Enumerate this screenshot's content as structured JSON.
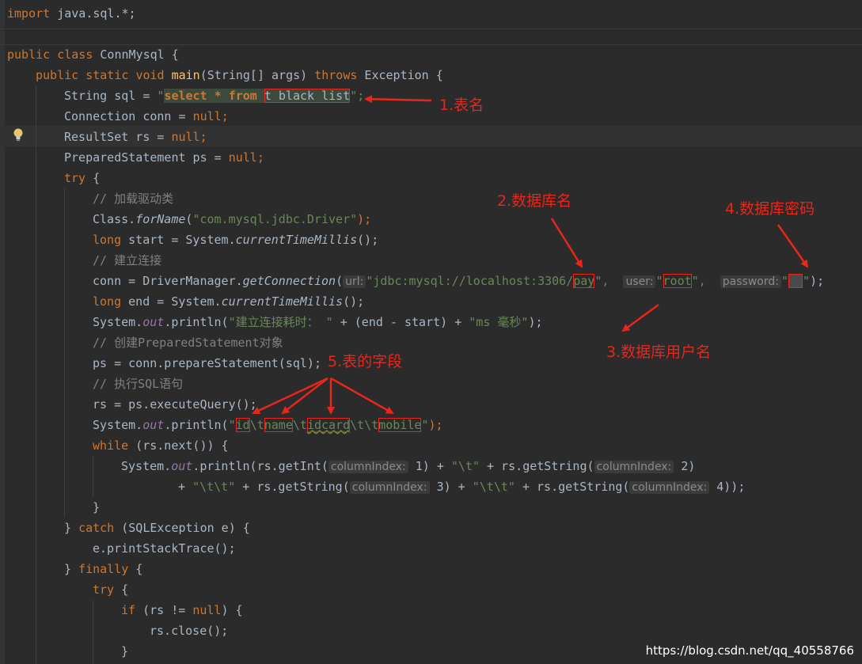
{
  "code": {
    "l01": {
      "a": "import",
      "b": " java.sql.*;"
    },
    "l03": {
      "a": "public",
      "b": " ",
      "c": "class",
      "d": " ConnMysql {"
    },
    "l04": {
      "a": "public",
      "b": " ",
      "c": "static",
      "d": " ",
      "e": "void",
      "f": " ",
      "g": "main",
      "h": "(String[] args) ",
      "i": "throws",
      "j": " Exception {"
    },
    "l05": {
      "a": "String sql = ",
      "b": "\"",
      "c": "select * from",
      "d": " ",
      "e": "t_black_list",
      "f": "\";"
    },
    "l06": {
      "a": "Connection conn = ",
      "b": "null",
      "c": ";"
    },
    "l07": {
      "a": "ResultSet rs = ",
      "b": "null",
      "c": ";"
    },
    "l08": {
      "a": "PreparedStatement ps = ",
      "b": "null",
      "c": ";"
    },
    "l09": {
      "a": "try",
      "b": " {"
    },
    "l10": {
      "a": "// 加载驱动类"
    },
    "l11": {
      "a": "Class.",
      "b": "forName",
      "c": "(",
      "d": "\"com.mysql.jdbc.Driver\"",
      "e": ");"
    },
    "l12": {
      "a": "long",
      "b": " start = System.",
      "c": "currentTimeMillis",
      "d": "();"
    },
    "l13": {
      "a": "// 建立连接"
    },
    "l14": {
      "a": "conn = DriverManager.",
      "b": "getConnection",
      "c": "(",
      "d": "url:",
      "e": "\"jdbc:mysql://localhost:3306/",
      "f": "pay",
      "g": "\",",
      "h": "user:",
      "i": "\"",
      "j": "root",
      "k": "\",",
      "l": "password:",
      "m": "\"",
      "n": "  ",
      "o": "\"",
      "p": ");"
    },
    "l15": {
      "a": "long",
      "b": " end = System.",
      "c": "currentTimeMillis",
      "d": "();"
    },
    "l16": {
      "a": "System.",
      "b": "out",
      "c": ".println(",
      "d": "\"建立连接耗时： \"",
      "e": " + (end - start) + ",
      "f": "\"ms 毫秒\"",
      "g": ");"
    },
    "l17": {
      "a": "// 创建PreparedStatement对象"
    },
    "l18": {
      "a": "ps = conn.prepareStatement(sql);"
    },
    "l19": {
      "a": "// 执行SQL语句"
    },
    "l20": {
      "a": "rs = ps.executeQuery();"
    },
    "l21": {
      "a": "System.",
      "b": "out",
      "c": ".println(",
      "d": "\"",
      "e": "id",
      "f": "\\t",
      "g": "name",
      "h": "\\t",
      "i": "idcard",
      "j": "\\t\\t",
      "k": "mobile",
      "l": "\"",
      "m": ");"
    },
    "l22": {
      "a": "while",
      "b": " (rs.next()) {"
    },
    "l23": {
      "a": "System.",
      "b": "out",
      "c": ".println(rs.getInt(",
      "d": "columnIndex:",
      "e": " 1) + ",
      "f": "\"\\t\"",
      "g": " + rs.getString(",
      "h": "columnIndex:",
      "i": " 2)"
    },
    "l24": {
      "a": "+ ",
      "b": "\"\\t\\t\"",
      "c": " + rs.getString(",
      "d": "columnIndex:",
      "e": " 3) + ",
      "f": "\"\\t\\t\"",
      "g": " + rs.getString(",
      "h": "columnIndex:",
      "i": " 4));"
    },
    "l25": {
      "a": "}"
    },
    "l26": {
      "a": "} ",
      "b": "catch",
      "c": " (SQLException e) {"
    },
    "l27": {
      "a": "e.printStackTrace();"
    },
    "l28": {
      "a": "} ",
      "b": "finally",
      "c": " {"
    },
    "l29": {
      "a": "try",
      "b": " {"
    },
    "l30": {
      "a": "if",
      "b": " (rs != ",
      "c": "null",
      "d": ") {"
    },
    "l31": {
      "a": "rs.close();"
    },
    "l32": {
      "a": "}"
    }
  },
  "annotations": {
    "a1": "1.表名",
    "a2": "2.数据库名",
    "a3": "3.数据库用户名",
    "a4": "4.数据库密码",
    "a5": "5.表的字段"
  },
  "watermark": "https://blog.csdn.net/qq_40558766",
  "colors": {
    "background": "#2b2b2b",
    "keyword": "#cc7832",
    "string": "#6a8759",
    "comment": "#808080",
    "method": "#ffc66d",
    "field": "#9876aa",
    "annotation": "#e8261c"
  },
  "icons": [
    "intention-bulb-icon"
  ]
}
